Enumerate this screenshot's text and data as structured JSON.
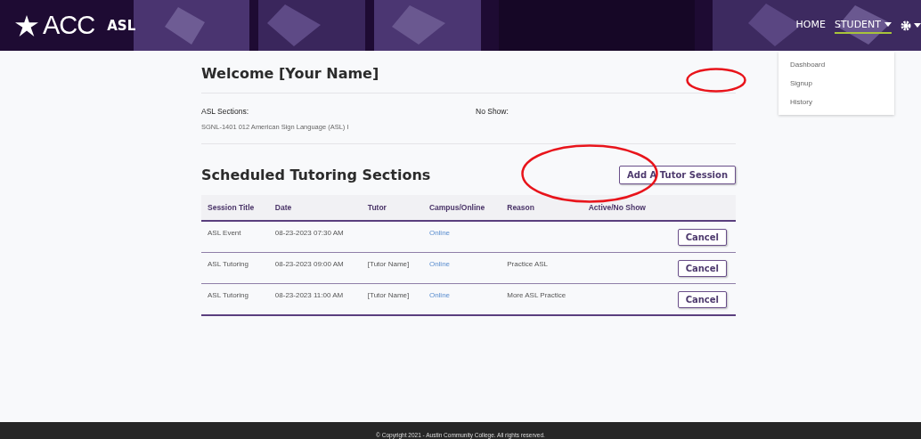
{
  "header": {
    "logo_text": "ACC",
    "app_name": "ASL",
    "nav": [
      {
        "label": "HOME",
        "selected": false,
        "has_caret": false
      },
      {
        "label": "STUDENT",
        "selected": true,
        "has_caret": true
      }
    ],
    "settings_caret": true
  },
  "dropdown": {
    "items": [
      "Dashboard",
      "Signup",
      "History"
    ]
  },
  "welcome": {
    "title": "Welcome [Your Name]"
  },
  "info": [
    {
      "label": "ASL Sections:",
      "value": "SGNL-1401 012 American Sign Language (ASL) I"
    },
    {
      "label": "No Show:"
    }
  ],
  "sessions": {
    "title": "Scheduled Tutoring Sections",
    "add_button": "Add A Tutor Session",
    "columns": [
      "Session Title",
      "Date",
      "Tutor",
      "Campus/Online",
      "Reason",
      "Active/No Show"
    ],
    "rows": [
      {
        "title": "ASL Event",
        "date": "08-23-2023 07:30 AM",
        "tutor": "",
        "mode": "Online",
        "reason": "",
        "action": "Cancel"
      },
      {
        "title": "ASL Tutoring",
        "date": "08-23-2023 09:00 AM",
        "tutor": "[Tutor Name]",
        "mode": "Online",
        "reason": "Practice ASL",
        "action": "Cancel"
      },
      {
        "title": "ASL Tutoring",
        "date": "08-23-2023 11:00 AM",
        "tutor": "[Tutor Name]",
        "mode": "Online",
        "reason": "More ASL Practice",
        "action": "Cancel"
      }
    ]
  },
  "annotations": [
    {
      "kind": "ellipse"
    },
    {
      "kind": "ellipse"
    }
  ],
  "footer": {
    "text": "© Copyright 2021 - Austin Community College. All rights reserved."
  }
}
